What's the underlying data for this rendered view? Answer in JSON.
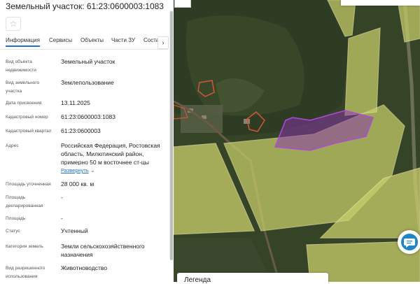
{
  "panel": {
    "title": "Земельный участок: 61:23:0600003:1083",
    "favorite_icon": "star-icon",
    "tabs": [
      "Информация",
      "Сервисы",
      "Объекты",
      "Части ЗУ",
      "Состав"
    ],
    "active_tab": "Информация",
    "next_tab_icon": "chevron-right-icon",
    "fields": [
      {
        "label": "Вид объекта недвижимости",
        "value": "Земельный участок"
      },
      {
        "label": "Вид земельного участка",
        "value": "Землепользование"
      },
      {
        "label": "Дата присвоения",
        "value": "13.11.2025"
      },
      {
        "label": "Кадастровый номер",
        "value": "61:23:0600003:1083"
      },
      {
        "label": "Кадастровый квартал",
        "value": "61:23:0600003"
      },
      {
        "label": "Адрес",
        "value": "Российская Федерация, Ростовская область, Милютинский район, примерно 50 м восточнее ст-цы",
        "link": "Развернуть"
      },
      {
        "label": "Площадь уточненная",
        "value": "28 000 кв. м"
      },
      {
        "label": "Площадь декларированная",
        "value": "-"
      },
      {
        "label": "Площадь",
        "value": "-"
      },
      {
        "label": "Статус",
        "value": "Учтенный"
      },
      {
        "label": "Категория земель",
        "value": "Земли сельскохозяйственного назначения"
      },
      {
        "label": "Вид разрешенного использования",
        "value": "Животноводство"
      }
    ]
  },
  "map": {
    "legend_title": "Легенда",
    "chat_icon": "chat-bubble-icon",
    "highlight_color": "#8a2fb0",
    "parcel_fill_color": "#c9cf6b",
    "parcel_outline_color": "#e6e29a"
  }
}
